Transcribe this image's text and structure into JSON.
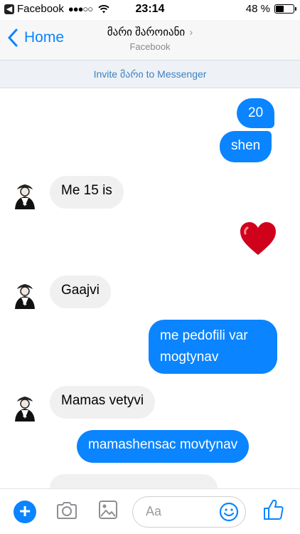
{
  "status_bar": {
    "carrier": "Facebook",
    "signal": "●●●○○",
    "time": "23:14",
    "battery_text": "48 %",
    "battery_level": 0.48
  },
  "header": {
    "back_label": "Home",
    "title": "მარი შაროიანი",
    "chevron": "›",
    "subtitle": "Facebook"
  },
  "invite": {
    "text": "Invite მარი to Messenger"
  },
  "messages": [
    {
      "side": "out",
      "text": "20"
    },
    {
      "side": "out",
      "text": "shen"
    },
    {
      "side": "in",
      "text": "Me 15 is"
    },
    {
      "side": "out",
      "type": "emoji",
      "icon": "heart-icon"
    },
    {
      "side": "in",
      "text": "Gaajvi"
    },
    {
      "side": "out",
      "text": "me pedofili var mogtynav",
      "lines": [
        "me pedofili var",
        "mogtynav"
      ]
    },
    {
      "side": "in",
      "text": "Mamas vetyvi"
    },
    {
      "side": "out",
      "text": "mamashensac movtynav"
    }
  ],
  "composer": {
    "placeholder": "Aa",
    "icons": [
      "plus-icon",
      "camera-icon",
      "image-icon",
      "emoji-icon",
      "like-icon"
    ]
  },
  "colors": {
    "accent": "#0a84ff",
    "incoming_bubble": "#f0f0f0",
    "heart": "#d0021b"
  }
}
